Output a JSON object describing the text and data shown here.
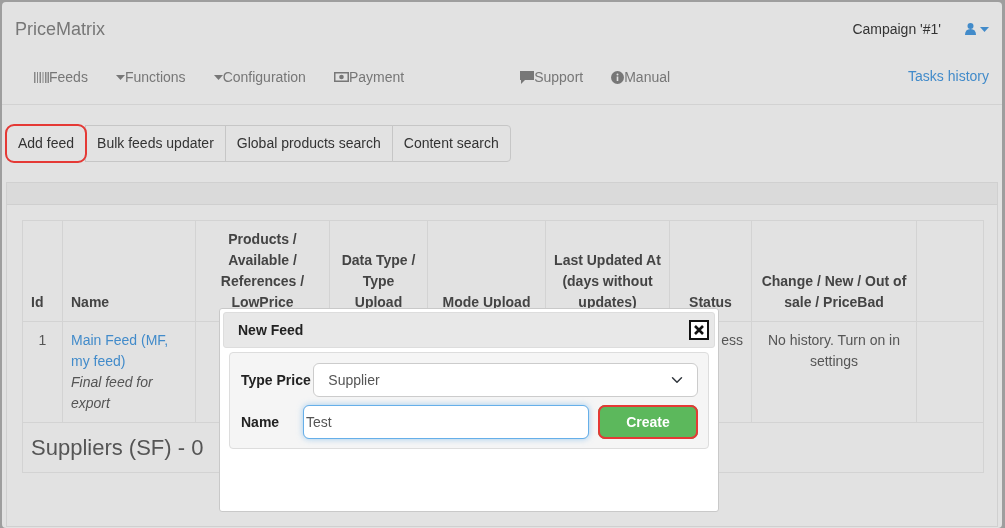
{
  "navbar": {
    "brand": "PriceMatrix",
    "campaign": "Campaign '#1'",
    "menu": [
      {
        "label": "Feeds"
      },
      {
        "label": "Functions"
      },
      {
        "label": "Configuration"
      },
      {
        "label": "Payment"
      },
      {
        "label": "Support"
      },
      {
        "label": "Manual"
      }
    ],
    "tasks_link": "Tasks history"
  },
  "toolbar": [
    {
      "label": "Add feed",
      "highlighted": true
    },
    {
      "label": "Bulk feeds updater",
      "highlighted": false
    },
    {
      "label": "Global products search",
      "highlighted": false
    },
    {
      "label": "Content search",
      "highlighted": false
    }
  ],
  "table": {
    "columns": [
      "Id",
      "Name",
      "Products / Available / References / LowPrice",
      "Data Type / Type Upload",
      "Mode Upload",
      "Last Updated At (days without updates)",
      "Status",
      "Change / New / Out of sale / PriceBad",
      ""
    ],
    "rows": [
      {
        "id": "1",
        "name_link": "Main Feed (MF, my feed)",
        "name_note": "Final feed for export",
        "status": "ess",
        "history": "No history. Turn on in settings"
      }
    ],
    "section_heading": "Suppliers (SF) - 0"
  },
  "dialog": {
    "title": "New Feed",
    "type_label": "Type Price",
    "type_value": "Supplier",
    "name_label": "Name",
    "name_value": "Test",
    "submit": {
      "label": "Create",
      "highlighted": true
    }
  }
}
